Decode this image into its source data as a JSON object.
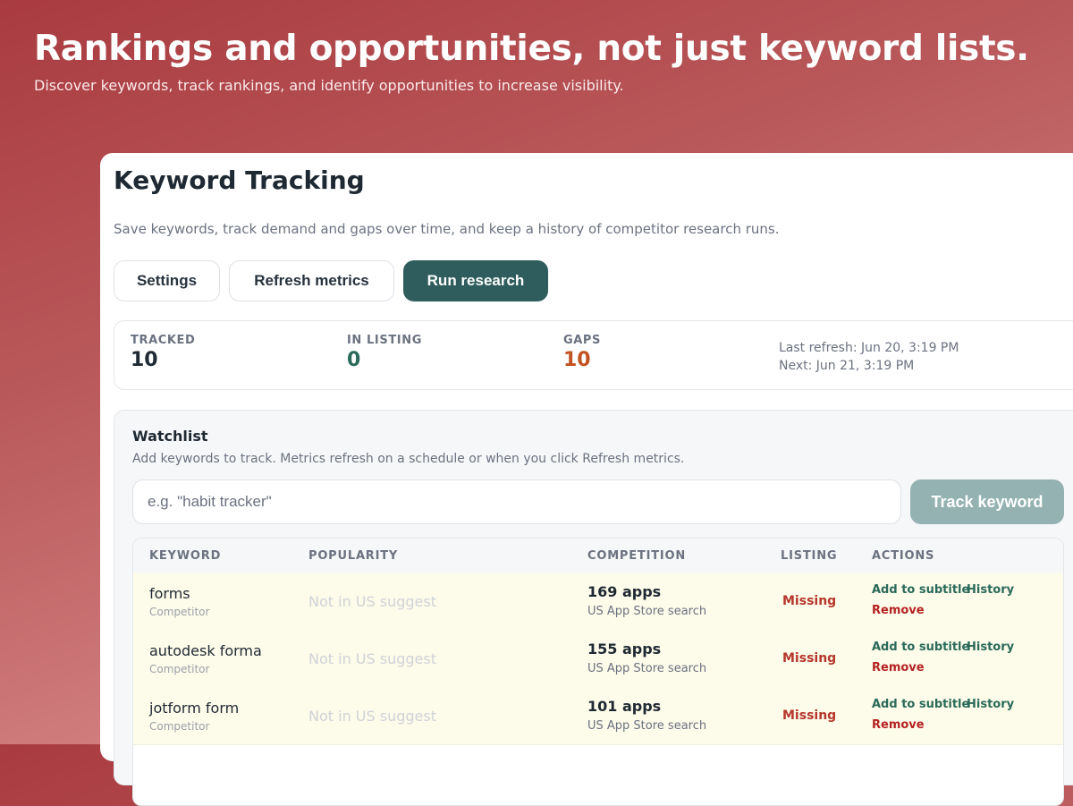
{
  "hero": {
    "title": "Rankings and opportunities, not just keyword lists.",
    "subtitle": "Discover keywords, track rankings, and identify opportunities to increase visibility."
  },
  "page": {
    "title": "Keyword Tracking",
    "description": "Save keywords, track demand and gaps over time, and keep a history of competitor research runs."
  },
  "toolbar": {
    "settings_label": "Settings",
    "refresh_label": "Refresh metrics",
    "research_label": "Run research"
  },
  "stats": {
    "tracked_label": "TRACKED",
    "tracked_value": "10",
    "in_listing_label": "IN LISTING",
    "in_listing_value": "0",
    "gaps_label": "GAPS",
    "gaps_value": "10",
    "last_refresh": "Last refresh: Jun 20, 3:19 PM",
    "next_refresh": "Next: Jun 21, 3:19 PM"
  },
  "watchlist": {
    "title": "Watchlist",
    "description": "Add keywords to track. Metrics refresh on a schedule or when you click Refresh metrics.",
    "input_placeholder": "e.g. \"habit tracker\"",
    "track_label": "Track keyword",
    "columns": [
      "KEYWORD",
      "POPULARITY",
      "COMPETITION",
      "LISTING",
      "ACTIONS"
    ],
    "rows": [
      {
        "keyword": "forms",
        "source": "Competitor",
        "popularity": "Not in US suggest",
        "competition": "169 apps",
        "competition_source": "US App Store search",
        "listing": "Missing",
        "action_subtitle": "Add to subtitle",
        "action_history": "History",
        "action_remove": "Remove"
      },
      {
        "keyword": "autodesk forma",
        "source": "Competitor",
        "popularity": "Not in US suggest",
        "competition": "155 apps",
        "competition_source": "US App Store search",
        "listing": "Missing",
        "action_subtitle": "Add to subtitle",
        "action_history": "History",
        "action_remove": "Remove"
      },
      {
        "keyword": "jotform form",
        "source": "Competitor",
        "popularity": "Not in US suggest",
        "competition": "101 apps",
        "competition_source": "US App Store search",
        "listing": "Missing",
        "action_subtitle": "Add to subtitle",
        "action_history": "History",
        "action_remove": "Remove"
      }
    ]
  },
  "colors": {
    "accent": "#2f5c5d",
    "in_listing": "#2a6a5a",
    "gaps": "#c2521f",
    "missing": "#b6362c"
  }
}
